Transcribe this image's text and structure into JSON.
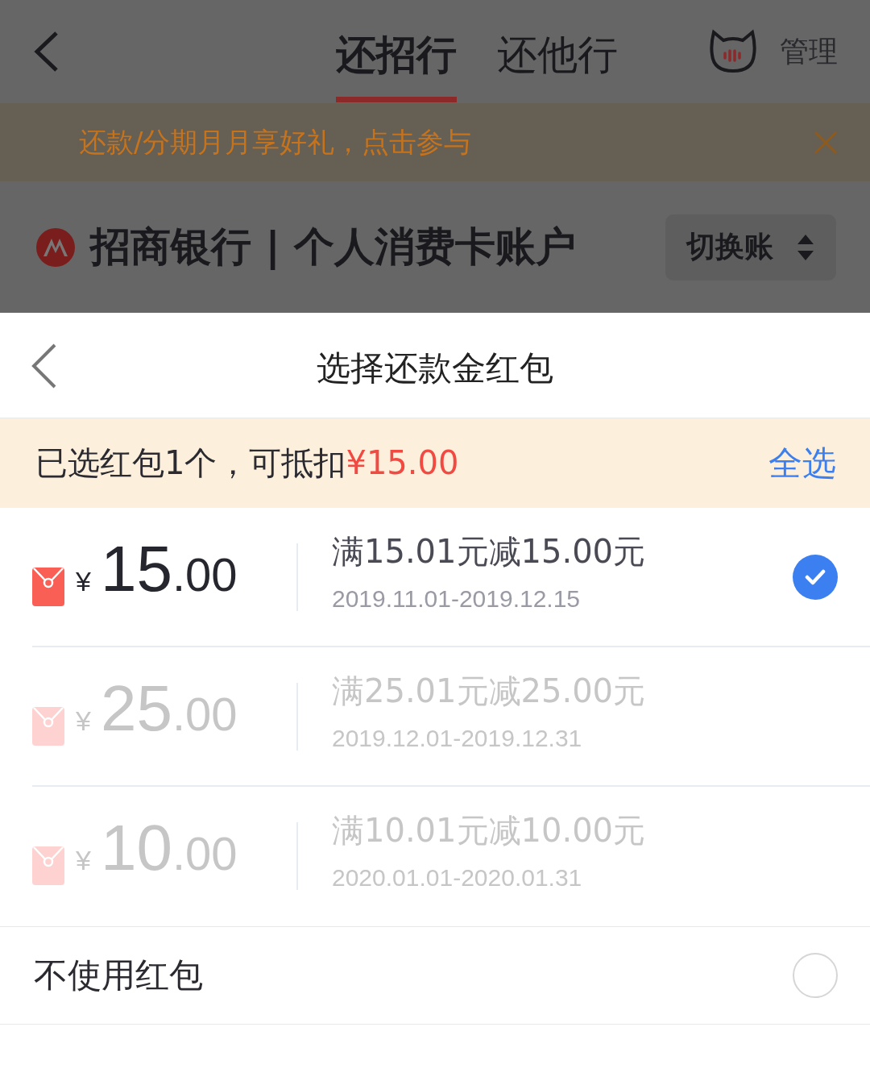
{
  "header": {
    "tabs": [
      {
        "label": "还招行",
        "selected": true
      },
      {
        "label": "还他行",
        "selected": false
      }
    ],
    "manage": "管理"
  },
  "banner": {
    "text": "还款/分期月月享好礼，点击参与"
  },
  "account": {
    "title": "招商银行 | 个人消费卡账户",
    "switch": "切换账"
  },
  "sheet": {
    "title": "选择还款金红包",
    "summary": {
      "text": "已选红包1个，可抵扣",
      "amount": "¥15.00"
    },
    "select_all": "全选",
    "packets": [
      {
        "currency": "¥",
        "whole": "15",
        "fraction": ".00",
        "rule": "满15.01元减15.00元",
        "period": "2019.11.01-2019.12.15",
        "available": true,
        "selected": true
      },
      {
        "currency": "¥",
        "whole": "25",
        "fraction": ".00",
        "rule": "满25.01元减25.00元",
        "period": "2019.12.01-2019.12.31",
        "available": false,
        "selected": false
      },
      {
        "currency": "¥",
        "whole": "10",
        "fraction": ".00",
        "rule": "满10.01元减10.00元",
        "period": "2020.01.01-2020.01.31",
        "available": false,
        "selected": false
      }
    ],
    "none_option": {
      "label": "不使用红包",
      "selected": false
    }
  }
}
